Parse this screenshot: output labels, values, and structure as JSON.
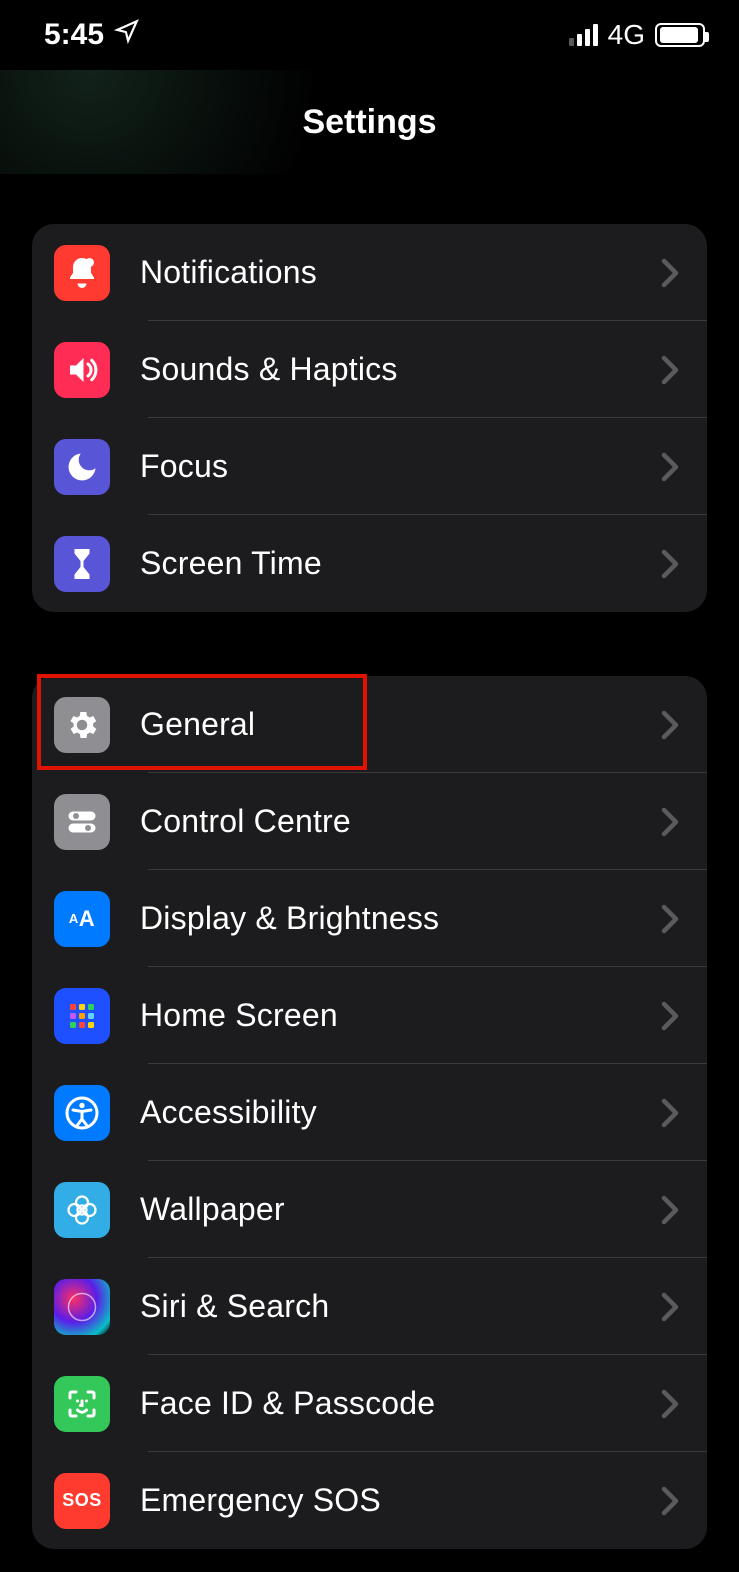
{
  "status_bar": {
    "time": "5:45",
    "network": "4G"
  },
  "header": {
    "title": "Settings"
  },
  "groups": [
    {
      "rows": [
        {
          "label": "Notifications"
        },
        {
          "label": "Sounds & Haptics"
        },
        {
          "label": "Focus"
        },
        {
          "label": "Screen Time"
        }
      ]
    },
    {
      "rows": [
        {
          "label": "General"
        },
        {
          "label": "Control Centre"
        },
        {
          "label": "Display & Brightness"
        },
        {
          "label": "Home Screen"
        },
        {
          "label": "Accessibility"
        },
        {
          "label": "Wallpaper"
        },
        {
          "label": "Siri & Search"
        },
        {
          "label": "Face ID & Passcode"
        },
        {
          "label": "Emergency SOS"
        }
      ]
    }
  ],
  "highlight": {
    "target": "General"
  }
}
